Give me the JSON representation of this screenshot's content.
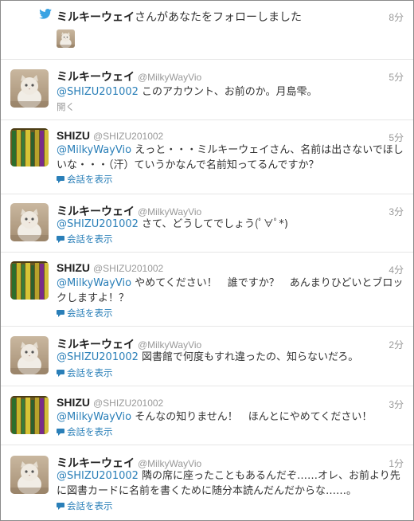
{
  "notification": {
    "name": "ミルキーウェイ",
    "text": "さんがあなたをフォローしました",
    "time": "8分"
  },
  "tweets": [
    {
      "name": "ミルキーウェイ",
      "handle": "@MilkyWayVio",
      "time": "5分",
      "mention": "@SHIZU201002",
      "body": " このアカウント、お前のか。月島雫。",
      "action": "開く"
    },
    {
      "name": "SHIZU",
      "handle": "@SHIZU201002",
      "time": "5分",
      "mention": "@MilkyWayVio",
      "body": " えっと・・・ミルキーウェイさん、名前は出さないでほしいな・・・（汗）ていうかなんで名前知ってるんですか？",
      "action": "会話を表示"
    },
    {
      "name": "ミルキーウェイ",
      "handle": "@MilkyWayVio",
      "time": "3分",
      "mention": "@SHIZU201002",
      "body": " さて、どうしてでしょう(ﾟ∀ﾟ*)",
      "action": "会話を表示"
    },
    {
      "name": "SHIZU",
      "handle": "@SHIZU201002",
      "time": "4分",
      "mention": "@MilkyWayVio",
      "body": " やめてください！　誰ですか？　あんまりひどいとブロックしますよ！？",
      "action": "会話を表示"
    },
    {
      "name": "ミルキーウェイ",
      "handle": "@MilkyWayVio",
      "time": "2分",
      "mention": "@SHIZU201002",
      "body": " 図書館で何度もすれ違ったの、知らないだろ。",
      "action": "会話を表示"
    },
    {
      "name": "SHIZU",
      "handle": "@SHIZU201002",
      "time": "3分",
      "mention": "@MilkyWayVio",
      "body": " そんなの知りません！　ほんとにやめてください！",
      "action": "会話を表示"
    },
    {
      "name": "ミルキーウェイ",
      "handle": "@MilkyWayVio",
      "time": "1分",
      "mention": "@SHIZU201002",
      "body": " 隣の席に座ったこともあるんだぞ……オレ、お前より先に図書カードに名前を書くために随分本読んだんだからな……。",
      "action": "会話を表示"
    }
  ],
  "colors": {
    "link": "#2a7fb8",
    "muted": "#999999",
    "bird": "#3aa3e3"
  },
  "icons": {
    "notification": "twitter-bird-icon",
    "conversation": "speech-bubble-icon"
  }
}
